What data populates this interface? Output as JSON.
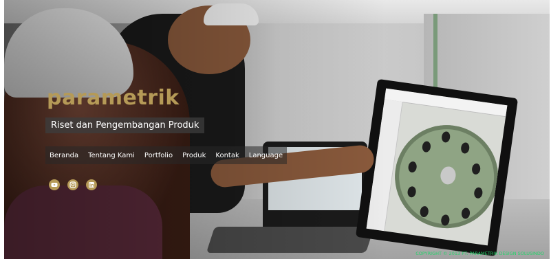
{
  "brand": {
    "name": "parametrik",
    "tagline": "Riset dan Pengembangan Produk",
    "accent_color": "#b59a57"
  },
  "nav": {
    "items": [
      {
        "label": "Beranda"
      },
      {
        "label": "Tentang Kami"
      },
      {
        "label": "Portfolio"
      },
      {
        "label": "Produk"
      },
      {
        "label": "Kontak"
      },
      {
        "label": "Language"
      }
    ]
  },
  "social": [
    {
      "icon": "youtube-icon"
    },
    {
      "icon": "instagram-icon"
    },
    {
      "icon": "linkedin-icon"
    }
  ],
  "footer": {
    "copyright": "COPYRIGHT © 2013 PT. PARAMETRIK DESIGN SOLUSINDO",
    "color": "#26d36b"
  }
}
